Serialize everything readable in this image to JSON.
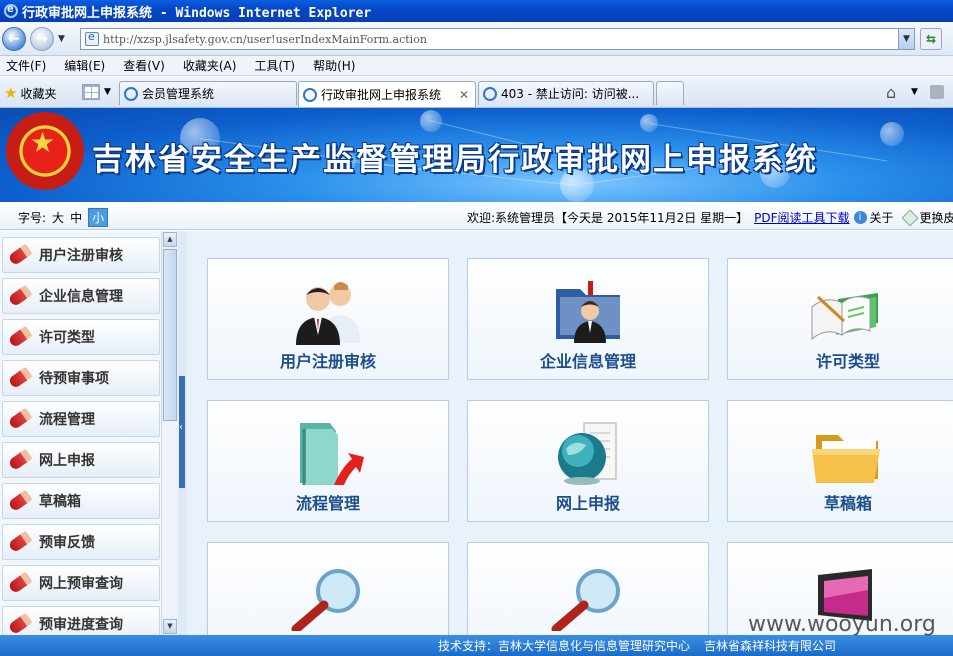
{
  "window": {
    "title": "行政审批网上申报系统 - Windows Internet Explorer"
  },
  "address": {
    "url": "http://xzsp.jlsafety.gov.cn/user!userIndexMainForm.action"
  },
  "menu": [
    "文件(F)",
    "编辑(E)",
    "查看(V)",
    "收藏夹(A)",
    "工具(T)",
    "帮助(H)"
  ],
  "favorites_label": "收藏夹",
  "tabs": [
    {
      "label": "会员管理系统"
    },
    {
      "label": "行政审批网上申报系统"
    },
    {
      "label": "403 - 禁止访问: 访问被..."
    }
  ],
  "banner": {
    "title": "吉林省安全生产监督管理局行政审批网上申报系统"
  },
  "infobar": {
    "font_label": "字号:",
    "sizes": [
      "大",
      "中",
      "小"
    ],
    "welcome": "欢迎:系统管理员【今天是 2015年11月2日 星期一】",
    "pdf_link": "PDF阅读工具下载",
    "about": "关于",
    "skin": "更换皮肤"
  },
  "sidebar": {
    "items": [
      {
        "label": "用户注册审核"
      },
      {
        "label": "企业信息管理"
      },
      {
        "label": "许可类型"
      },
      {
        "label": "待预审事项"
      },
      {
        "label": "流程管理"
      },
      {
        "label": "网上申报"
      },
      {
        "label": "草稿箱"
      },
      {
        "label": "预审反馈"
      },
      {
        "label": "网上预审查询"
      },
      {
        "label": "预审进度查询"
      }
    ]
  },
  "tiles": [
    {
      "label": "用户注册审核",
      "icon": "users-icon"
    },
    {
      "label": "企业信息管理",
      "icon": "folder-user-icon"
    },
    {
      "label": "许可类型",
      "icon": "book-icon"
    },
    {
      "label": "流程管理",
      "icon": "folder-arrow-icon"
    },
    {
      "label": "网上申报",
      "icon": "globe-document-icon"
    },
    {
      "label": "草稿箱",
      "icon": "folder-icon"
    },
    {
      "label": "",
      "icon": "magnifier-icon"
    },
    {
      "label": "",
      "icon": "magnifier-icon"
    },
    {
      "label": "",
      "icon": "monitor-icon"
    }
  ],
  "footer": {
    "support": "技术支持：吉林大学信息化与信息管理研究中心",
    "company": "吉林省森祥科技有限公司"
  },
  "watermark": "www.wooyun.org"
}
